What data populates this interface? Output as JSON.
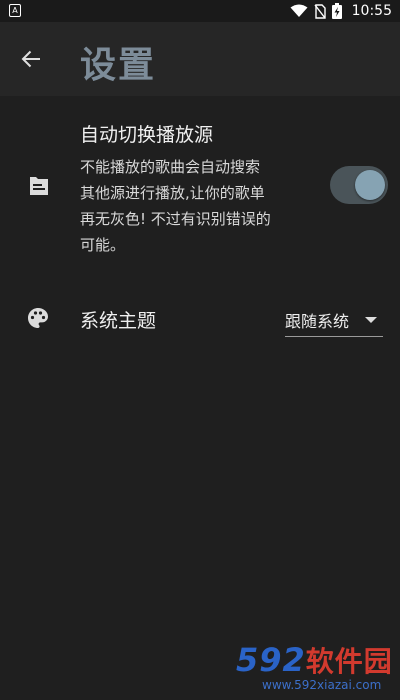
{
  "status_bar": {
    "app_icon_letter": "A",
    "time": "10:55",
    "icons": [
      "wifi-icon",
      "no-sim-icon",
      "battery-charging-icon"
    ]
  },
  "app_bar": {
    "back_icon": "arrow-left-icon",
    "title": "设置"
  },
  "settings": {
    "auto_switch": {
      "icon": "document-icon",
      "title": "自动切换播放源",
      "description_lines": [
        "不能播放的歌曲会自动搜索",
        "其他源进行播放,让你的歌单",
        "再无灰色! 不过有识别错误的",
        "可能。"
      ],
      "enabled": true
    },
    "theme": {
      "icon": "palette-icon",
      "label": "系统主题",
      "selected": "跟随系统"
    }
  },
  "watermark": {
    "logo_num": "592",
    "logo_cn": "软件园",
    "url": "www.592xiazai.com"
  },
  "colors": {
    "background": "#1f1f1f",
    "app_bar": "#262626",
    "title": "#7d8c99",
    "toggle_track": "#4a5459",
    "toggle_knob": "#86a3b3"
  }
}
